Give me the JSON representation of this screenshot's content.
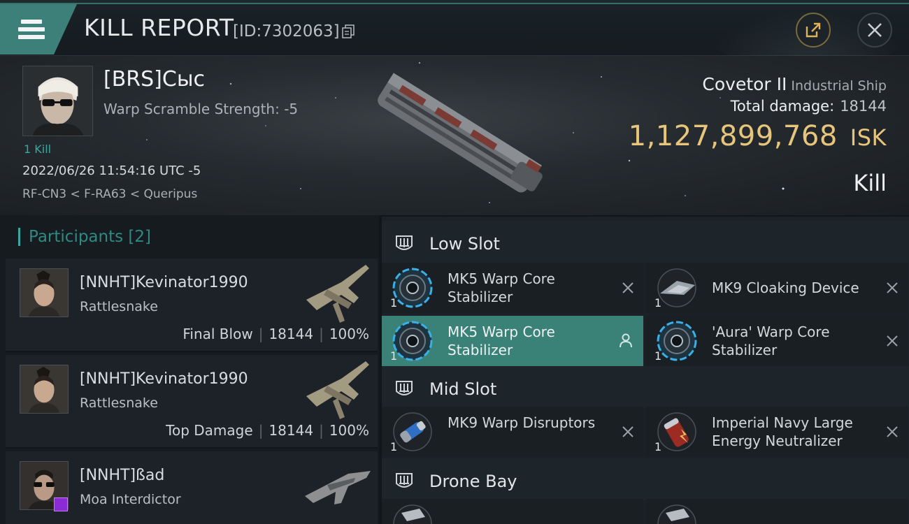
{
  "header": {
    "title": "KILL REPORT",
    "report_id": "[ID:7302063]"
  },
  "victim": {
    "name": "[BRS]Сыс",
    "warp_scramble": "Warp Scramble Strength: -5",
    "kills": "1 Kill",
    "datetime": "2022/06/26 11:54:16 UTC -5",
    "location": "RF-CN3 < F-RA63 < Queripus",
    "ship_name": "Covetor II",
    "ship_type": "Industrial Ship",
    "total_damage_label": "Total damage:",
    "total_damage_value": "18144",
    "isk_value": "1,127,899,768",
    "isk_unit": "ISK",
    "result": "Kill"
  },
  "participants": {
    "title": "Participants",
    "count": "[2]",
    "rows": [
      {
        "name": "[NNHT]Kevinator1990",
        "ship": "Rattlesnake",
        "role": "Final Blow",
        "damage": "18144",
        "percent": "100%"
      },
      {
        "name": "[NNHT]Kevinator1990",
        "ship": "Rattlesnake",
        "role": "Top Damage",
        "damage": "18144",
        "percent": "100%"
      },
      {
        "name": "[NNHT]ßad",
        "ship": "Moa Interdictor"
      }
    ],
    "separator": "|"
  },
  "fitting": {
    "low_slot": {
      "title": "Low Slot",
      "modules": [
        {
          "name": "MK5 Warp Core Stabilizer",
          "qty": "1"
        },
        {
          "name": "MK9 Cloaking Device",
          "qty": "1"
        },
        {
          "name": "MK5 Warp Core Stabilizer",
          "qty": "1"
        },
        {
          "name": "'Aura' Warp Core Stabilizer",
          "qty": "1"
        }
      ]
    },
    "mid_slot": {
      "title": "Mid Slot",
      "modules": [
        {
          "name": "MK9 Warp Disruptors",
          "qty": "1"
        },
        {
          "name": "Imperial Navy Large Energy Neutralizer",
          "qty": "1"
        }
      ]
    },
    "drone_bay": {
      "title": "Drone Bay"
    }
  },
  "colors": {
    "accent_teal": "#3d8079",
    "isk_gold": "#e7c57a",
    "selected_row": "#3a8178"
  },
  "icons": [
    "menu-icon",
    "copy-icon",
    "share-icon",
    "close-icon",
    "slot-icon",
    "remove-icon",
    "user-icon"
  ]
}
